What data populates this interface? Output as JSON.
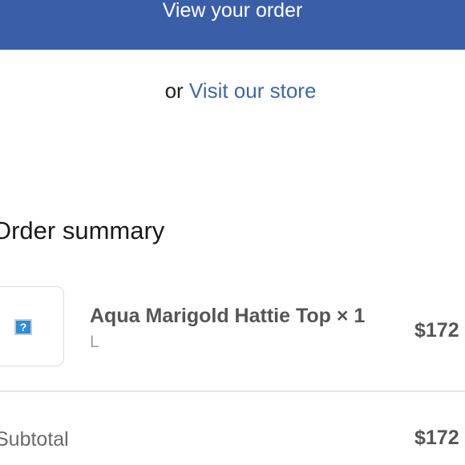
{
  "header": {
    "cta_label": "View your order"
  },
  "store_line": {
    "prefix": "or ",
    "link_label": "Visit our store"
  },
  "order_summary": {
    "heading": "Order summary",
    "items": [
      {
        "name": "Aqua Marigold Hattie Top × 1",
        "variant": "L",
        "price": "$172",
        "image_icon": "missing-image-question-mark"
      }
    ],
    "subtotal_label": "Subtotal",
    "subtotal_value": "$172"
  },
  "colors": {
    "button_background": "#3a5ea8",
    "link": "#3a6aa8"
  }
}
